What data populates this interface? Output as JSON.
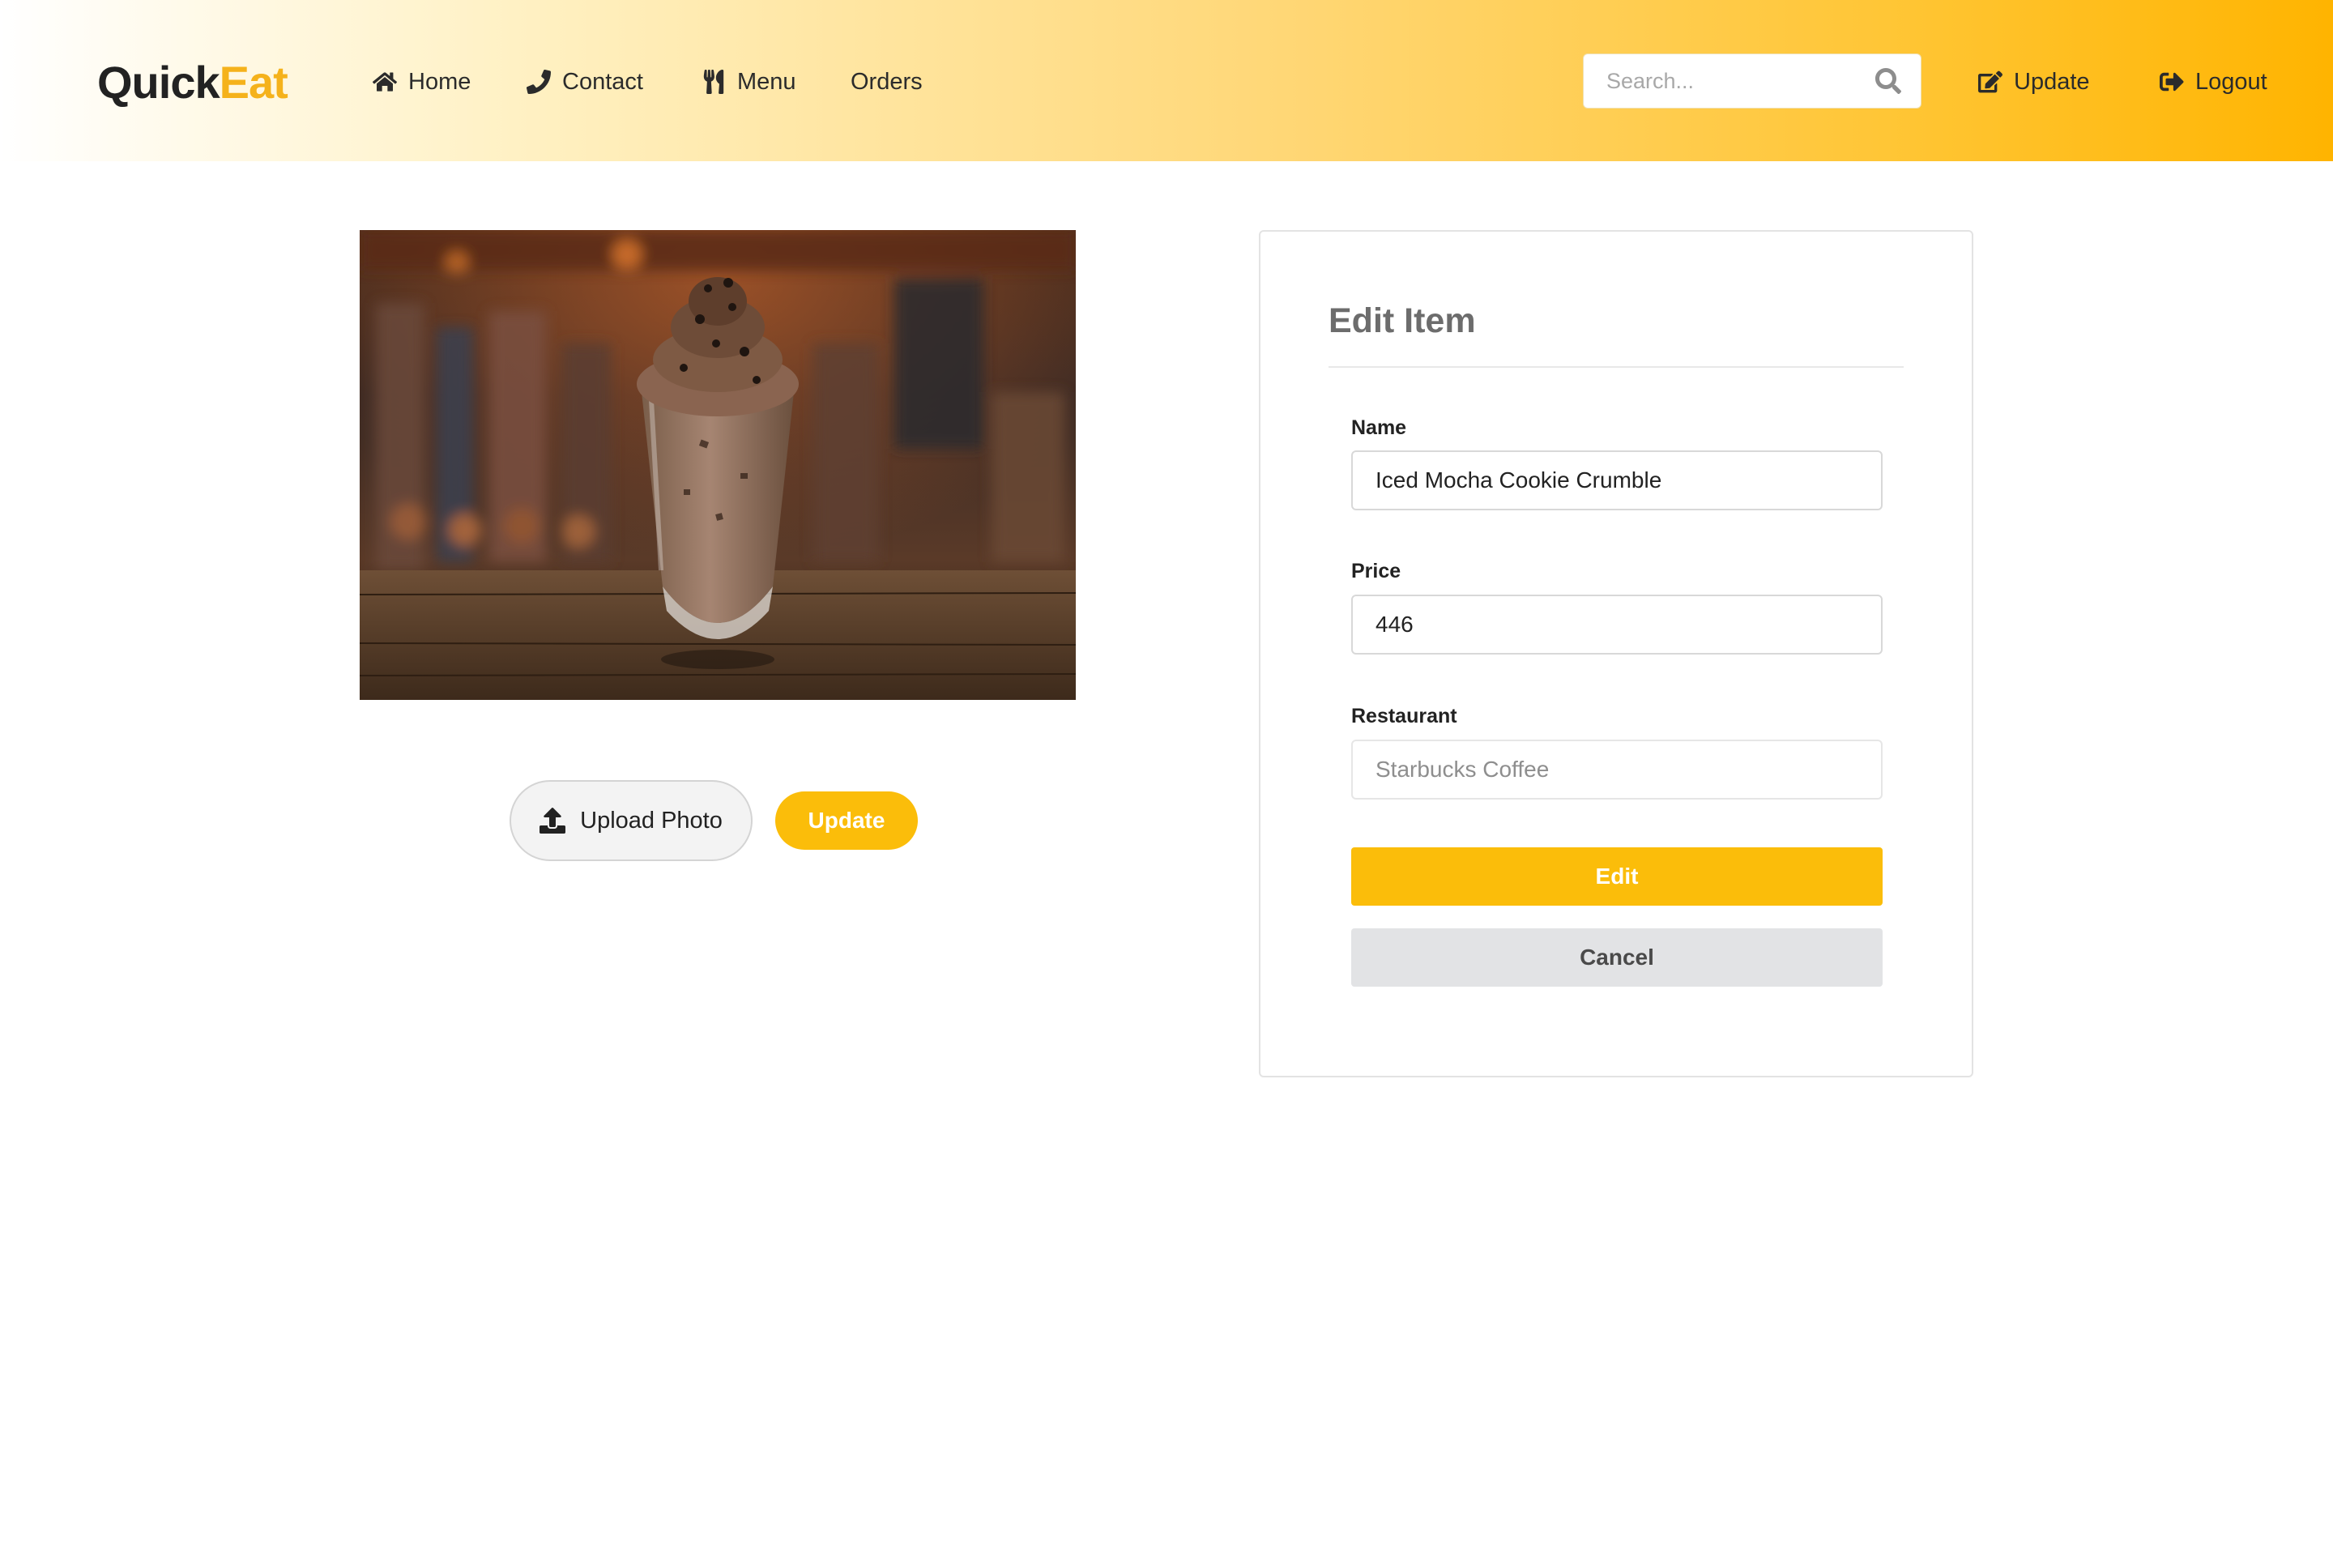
{
  "brand": {
    "part1": "Quick",
    "part2": "Eat",
    "accent_color": "#f5b21b"
  },
  "nav": {
    "items": [
      {
        "label": "Home",
        "icon": "home-icon"
      },
      {
        "label": "Contact",
        "icon": "phone-icon"
      },
      {
        "label": "Menu",
        "icon": "utensils-icon"
      },
      {
        "label": "Orders",
        "icon": ""
      }
    ],
    "search_placeholder": "Search...",
    "update_label": "Update",
    "logout_label": "Logout"
  },
  "product": {
    "image_alt": "Iced Mocha Cookie Crumble",
    "upload_label": "Upload Photo",
    "update_label": "Update"
  },
  "form": {
    "title": "Edit Item",
    "name_label": "Name",
    "name_value": "Iced Mocha Cookie Crumble",
    "price_label": "Price",
    "price_value": "446",
    "restaurant_label": "Restaurant",
    "restaurant_value": "Starbucks Coffee",
    "edit_label": "Edit",
    "cancel_label": "Cancel"
  },
  "colors": {
    "primary": "#fbbd0a",
    "secondary": "#e2e3e5",
    "header_gradient_end": "#ffb400"
  }
}
